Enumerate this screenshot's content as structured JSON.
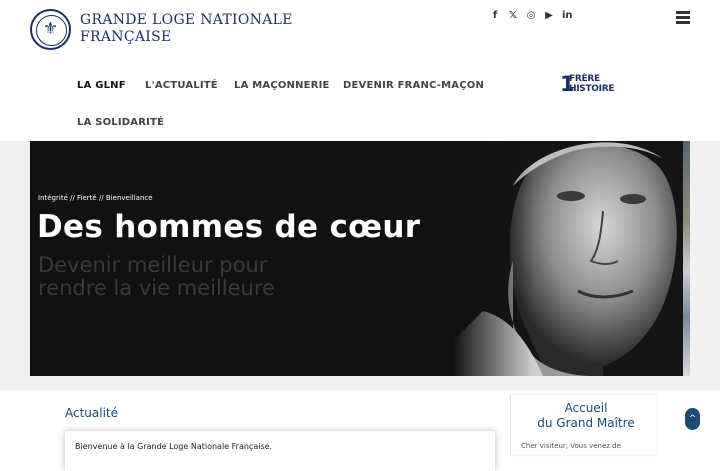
{
  "brand": {
    "line1": "GRANDE  LOGE  NATIONALE",
    "line2": "FRANÇAISE"
  },
  "social": [
    "f",
    "𝕏",
    "◎",
    "▶",
    "in"
  ],
  "nav": [
    "LA GLNF",
    "L'ACTUALITÉ",
    "LA MAÇONNERIE",
    "DEVENIR FRANC-MAÇON",
    "LA SOLIDARITÉ"
  ],
  "frere_logo": {
    "numeral": "1",
    "word1": "FRÈRE",
    "word2": "HISTOIRE"
  },
  "hero": {
    "tagline": "Intégrité // Fierté // Bienveillance",
    "headline": "Des hommes de cœur",
    "subline_1": "Devenir meilleur pour",
    "subline_2": "rendre la vie meilleure"
  },
  "actualite": {
    "title": "Actualité",
    "intro": "Bienvenue à la Grande Loge Nationale Française."
  },
  "sidebar": {
    "title_1": "Accueil",
    "title_2": "du Grand Maître",
    "intro": "Cher visiteur, Vous venez de"
  },
  "back_to_top": "^"
}
